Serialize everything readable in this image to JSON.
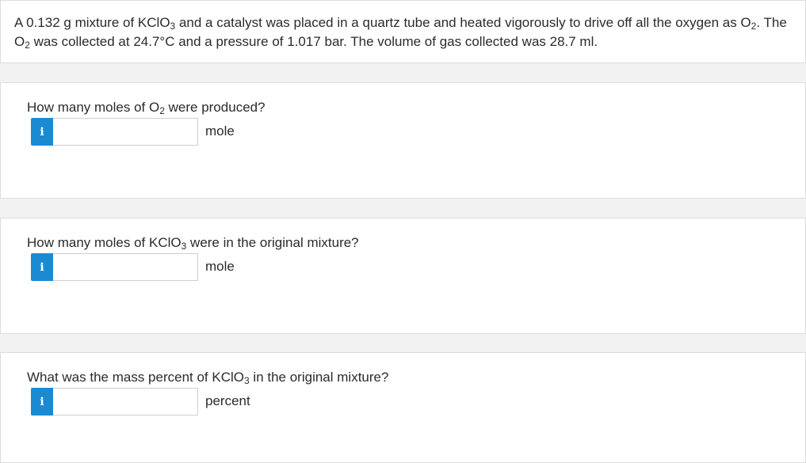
{
  "intro": {
    "p1": "A 0.132 g mixture of KClO",
    "p1_sub": "3",
    "p2": " and a catalyst was placed in a quartz tube and heated vigorously to drive off all the oxygen as O",
    "p2_sub": "2",
    "p3": ". The O",
    "p3_sub": "2",
    "p4": " was collected at  24.7°C and a pressure of  1.017 bar. The volume of gas collected was  28.7 ml."
  },
  "questions": [
    {
      "t1": "How many moles of O",
      "sub": "2",
      "t2": " were produced?",
      "info_icon": "i",
      "value": "",
      "unit": "mole"
    },
    {
      "t1": "How many moles of KClO",
      "sub": "3",
      "t2": " were in the original mixture?",
      "info_icon": "i",
      "value": "",
      "unit": "mole"
    },
    {
      "t1": "What was the mass percent of KClO",
      "sub": "3",
      "t2": " in the original mixture?",
      "info_icon": "i",
      "value": "",
      "unit": "percent"
    }
  ],
  "colors": {
    "info_button": "#1a8ad3",
    "background": "#f2f2f2",
    "card": "#ffffff"
  }
}
